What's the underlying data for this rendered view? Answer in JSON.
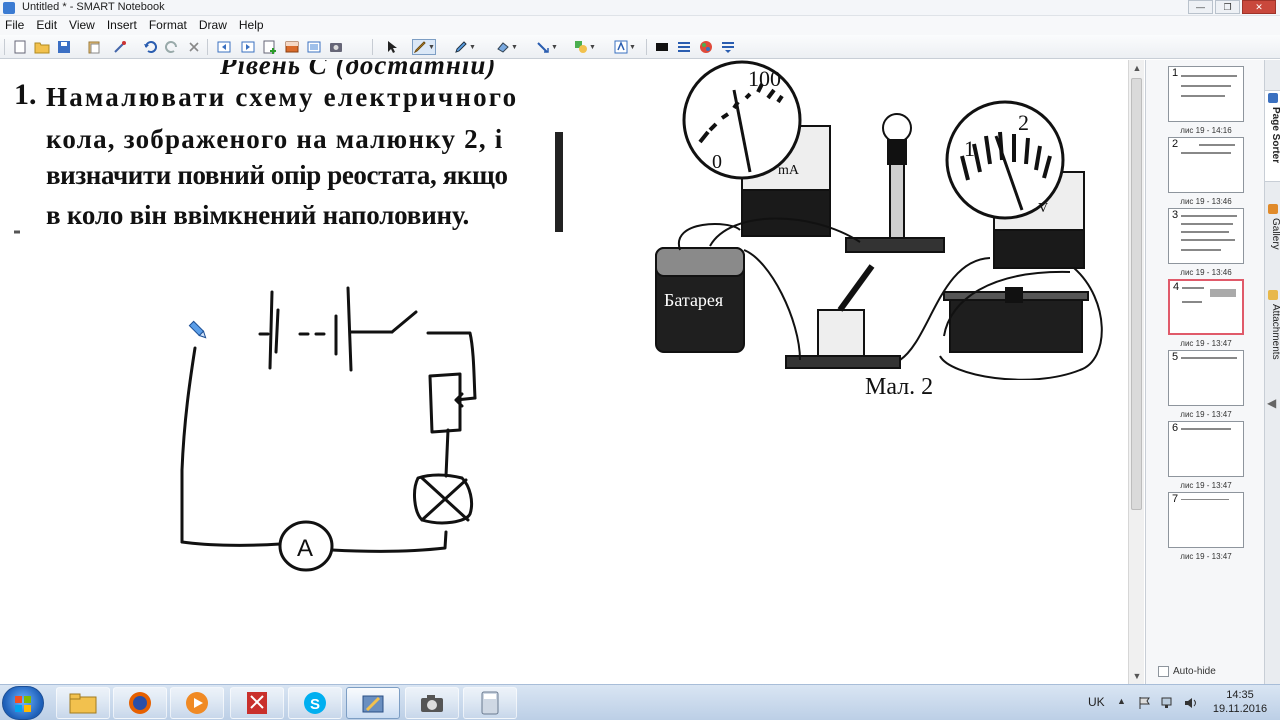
{
  "window": {
    "title": "Untitled * - SMART Notebook",
    "minimize": "—",
    "maximize": "❐",
    "close": "✕"
  },
  "menu": [
    "File",
    "Edit",
    "View",
    "Insert",
    "Format",
    "Draw",
    "Help"
  ],
  "canvas": {
    "header_cut": "Рівень С (достатній)",
    "number": "1.",
    "lines": [
      "Намалювати схему електричного",
      "кола, зображеного на малюнку 2, і",
      "визначити повний опір реостата, якщо",
      "в коло він ввімкнений наполовину."
    ],
    "figure": {
      "battery_label": "Батарея",
      "ammeter_scale_high": "100",
      "ammeter_scale_low": "0",
      "ammeter_unit": "mA",
      "voltmeter_scale_1": "1",
      "voltmeter_scale_2": "2",
      "voltmeter_unit": "V",
      "caption": "Мал. 2"
    },
    "circuit_ammeter_label": "A"
  },
  "page_sorter": {
    "pages": [
      {
        "number": "1",
        "caption": "лис 19 - 14:16",
        "selected": false
      },
      {
        "number": "2",
        "caption": "лис 19 - 13:46",
        "selected": false
      },
      {
        "number": "3",
        "caption": "лис 19 - 13:46",
        "selected": false
      },
      {
        "number": "4",
        "caption": "лис 19 - 13:47",
        "selected": true
      },
      {
        "number": "5",
        "caption": "лис 19 - 13:47",
        "selected": false
      },
      {
        "number": "6",
        "caption": "лис 19 - 13:47",
        "selected": false
      },
      {
        "number": "7",
        "caption": "лис 19 - 13:47",
        "selected": false
      }
    ],
    "autohide_label": "Auto-hide"
  },
  "side_tabs": [
    "Page Sorter",
    "Gallery",
    "Attachments"
  ],
  "taskbar": {
    "language": "UK",
    "time": "14:35",
    "date": "19.11.2016"
  },
  "colors": {
    "selected_page_border": "#e05a6a",
    "taskbar": "#c8d8ec",
    "ink": "#111111"
  }
}
